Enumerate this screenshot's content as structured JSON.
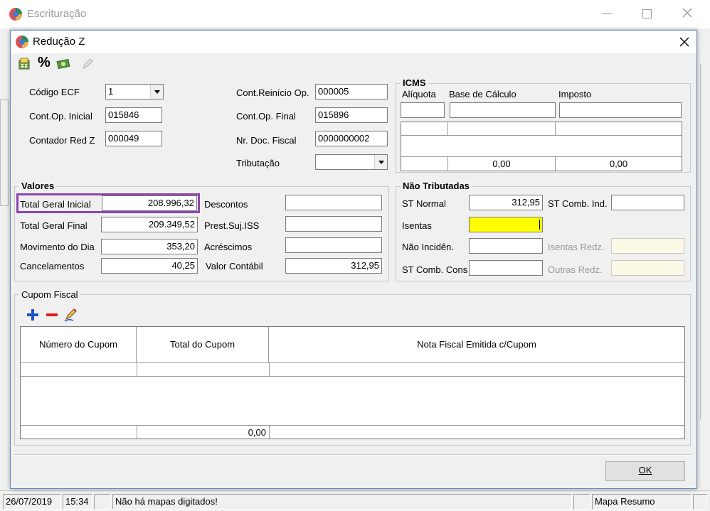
{
  "outer_window": {
    "title": "Escrituração"
  },
  "status_bar": {
    "date": "26/07/2019",
    "time": "15:34",
    "message": "Não há mapas digitados!",
    "mode": "Mapa Resumo"
  },
  "dialog": {
    "title": "Redução Z",
    "toolbar": [
      "calculator-icon",
      "percent-icon",
      "money-icon",
      "edit-disabled-icon"
    ]
  },
  "header_fields": {
    "codigo_ecf": {
      "label": "Código ECF",
      "value": "1"
    },
    "cont_op_inicial": {
      "label": "Cont.Op. Inicial",
      "value": "015846"
    },
    "contador_red_z": {
      "label": "Contador Red Z",
      "value": "000049"
    },
    "cont_reinicio_op": {
      "label": "Cont.Reinício Op.",
      "value": "000005"
    },
    "cont_op_final": {
      "label": "Cont.Op. Final",
      "value": "015896"
    },
    "nr_doc_fiscal": {
      "label": "Nr. Doc. Fiscal",
      "value": "0000000002"
    },
    "tributacao": {
      "label": "Tributação",
      "value": ""
    }
  },
  "icms": {
    "title": "ICMS",
    "col_aliquota": "Alíquota",
    "col_base": "Base de Cálculo",
    "col_imposto": "Imposto",
    "total_base": "0,00",
    "total_imposto": "0,00"
  },
  "valores": {
    "title": "Valores",
    "total_geral_inicial": {
      "label": "Total Geral Inicial",
      "value": "208.996,32"
    },
    "total_geral_final": {
      "label": "Total Geral Final",
      "value": "209.349,52"
    },
    "movimento_do_dia": {
      "label": "Movimento do Dia",
      "value": "353,20"
    },
    "cancelamentos": {
      "label": "Cancelamentos",
      "value": "40,25"
    },
    "descontos": {
      "label": "Descontos",
      "value": ""
    },
    "prest_suj_iss": {
      "label": "Prest.Suj.ISS",
      "value": ""
    },
    "acrescimos": {
      "label": "Acréscimos",
      "value": ""
    },
    "valor_contabil": {
      "label": "Valor Contábil",
      "value": "312,95"
    }
  },
  "nao_tributadas": {
    "title": "Não Tributadas",
    "st_normal": {
      "label": "ST Normal",
      "value": "312,95"
    },
    "st_comb_ind": {
      "label": "ST Comb. Ind.",
      "value": ""
    },
    "isentas": {
      "label": "Isentas",
      "value": ""
    },
    "nao_inciden": {
      "label": "Não Incidên.",
      "value": ""
    },
    "isentas_redz": {
      "label": "Isentas Redz.",
      "value": ""
    },
    "st_comb_cons": {
      "label": "ST Comb. Cons",
      "value": ""
    },
    "outras_redz": {
      "label": "Outras Redz.",
      "value": ""
    }
  },
  "cupom_fiscal": {
    "title": "Cupom Fiscal",
    "columns": [
      "Número do Cupom",
      "Total do Cupom",
      "Nota Fiscal Emitida c/Cupom"
    ],
    "total": "0,00"
  },
  "ok_button": "OK",
  "colors": {
    "highlight_border": "#8e44ad",
    "focus_field": "#ffff00",
    "disabled_field": "#fcfae6"
  }
}
